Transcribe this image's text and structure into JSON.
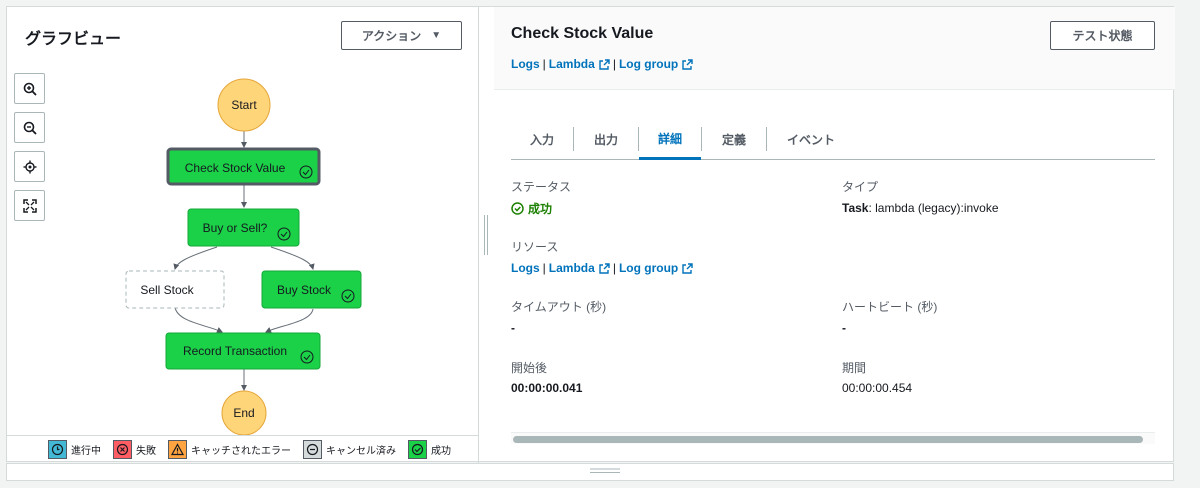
{
  "graph_panel": {
    "title": "グラフビュー",
    "action_button": "アクション",
    "tools": [
      "zoom-in-icon",
      "zoom-out-icon",
      "center-icon",
      "fit-icon"
    ]
  },
  "nodes": {
    "start": "Start",
    "check": "Check Stock Value",
    "buy_or_sell": "Buy or Sell?",
    "sell": "Sell Stock",
    "buy": "Buy Stock",
    "record": "Record Transaction",
    "end": "End"
  },
  "legend": {
    "in_progress": "進行中",
    "failed": "失敗",
    "caught_error": "キャッチされたエラー",
    "cancelled": "キャンセル済み",
    "succeeded": "成功"
  },
  "colors": {
    "success_green": "#1ad148",
    "start_end_yellow": "#ffd57a",
    "link_blue": "#0073bb",
    "status_green": "#1d8102"
  },
  "detail_panel": {
    "title": "Check Stock Value",
    "test_button": "テスト状態",
    "links": {
      "logs": "Logs",
      "lambda": "Lambda",
      "log_group": "Log group"
    },
    "tabs": [
      "入力",
      "出力",
      "詳細",
      "定義",
      "イベント"
    ],
    "active_tab": "詳細",
    "fields": {
      "status_label": "ステータス",
      "status_value": "成功",
      "type_label": "タイプ",
      "type_bold": "Task",
      "type_value": ": lambda (legacy):invoke",
      "resource_label": "リソース",
      "timeout_label": "タイムアウト (秒)",
      "timeout_value": "-",
      "heartbeat_label": "ハートビート (秒)",
      "heartbeat_value": "-",
      "start_label": "開始後",
      "start_value": "00:00:00.041",
      "duration_label": "期間",
      "duration_value": "00:00:00.454"
    }
  }
}
